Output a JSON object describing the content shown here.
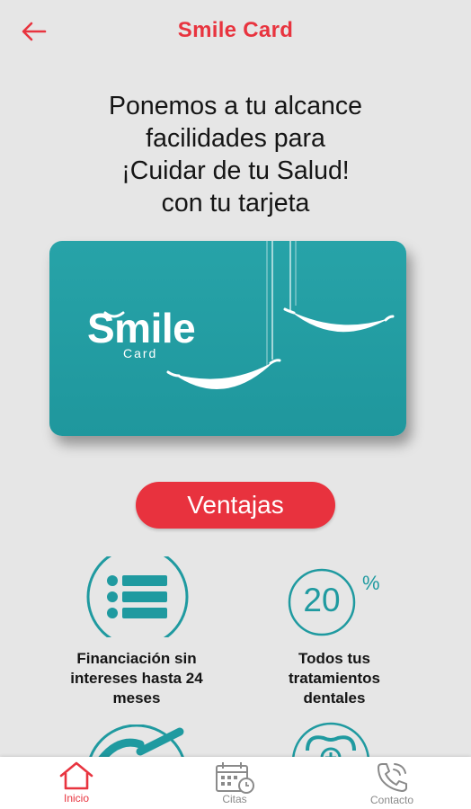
{
  "header": {
    "title": "Smile Card",
    "back_icon": "arrow-left-icon"
  },
  "intro": {
    "lines": [
      "Ponemos a tu alcance",
      "facilidades para",
      "¡Cuidar de tu Salud!",
      "con tu tarjeta"
    ]
  },
  "card": {
    "logo": "Smile",
    "sub": "Card"
  },
  "ventajas_button": "Ventajas",
  "features": [
    {
      "icon": "list-icon",
      "lines": [
        "Financiación sin",
        "intereses hasta 24",
        "meses"
      ]
    },
    {
      "icon": "percent-20-icon",
      "badge": "20",
      "percent": "%",
      "lines": [
        "Todos tus",
        "tratamientos",
        "dentales"
      ]
    }
  ],
  "nav": {
    "items": [
      {
        "label": "Inicio",
        "icon": "home-icon",
        "active": true
      },
      {
        "label": "Citas",
        "icon": "calendar-clock-icon",
        "active": false
      },
      {
        "label": "Contacto",
        "icon": "phone-icon",
        "active": false
      }
    ]
  },
  "colors": {
    "accent": "#e8343f",
    "teal": "#1f9aa0",
    "background": "#e6e6e6"
  }
}
